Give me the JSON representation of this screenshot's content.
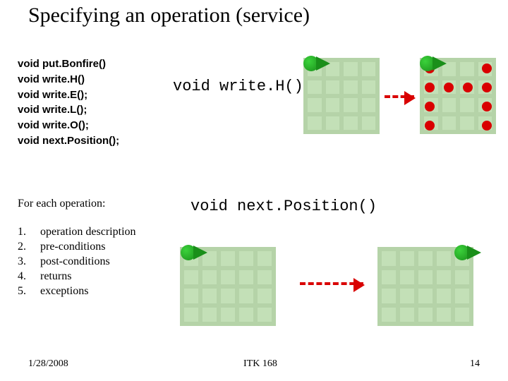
{
  "title": "Specifying an operation (service)",
  "ops": {
    "l1": "void put.Bonfire()",
    "l2": "void write.H()",
    "l3": "void write.E();",
    "l4": "void write.L();",
    "l5": "void write.O();",
    "l6": "void next.Position();"
  },
  "foreach": "For each operation:",
  "list": {
    "i1": {
      "num": "1.",
      "txt": "operation description"
    },
    "i2": {
      "num": "2.",
      "txt": "pre-conditions"
    },
    "i3": {
      "num": "3.",
      "txt": "post-conditions"
    },
    "i4": {
      "num": "4.",
      "txt": "returns"
    },
    "i5": {
      "num": "5.",
      "txt": "exceptions"
    }
  },
  "label1": "void write.H()",
  "label2": "void next.Position()",
  "footer": {
    "date": "1/28/2008",
    "mid": "ITK 168",
    "page": "14"
  }
}
